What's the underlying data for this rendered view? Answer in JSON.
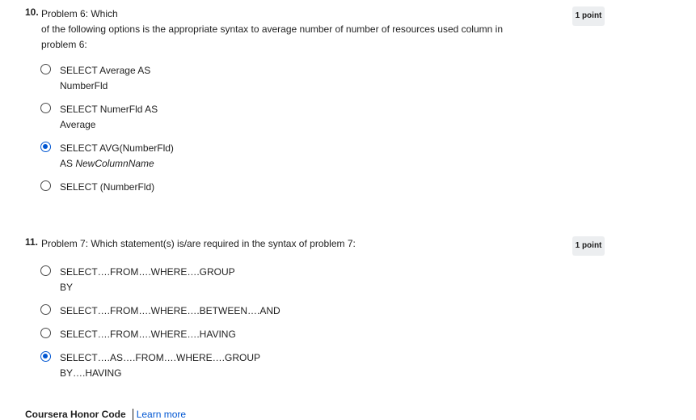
{
  "questions": [
    {
      "number": "10.",
      "text_line1": "Problem 6: Which",
      "text_line2": "of the following options is the appropriate syntax to average number of number of resources used column in",
      "text_line3": "problem 6:",
      "points": "1 point",
      "options": [
        {
          "line1": "SELECT Average AS",
          "line2": "NumberFld",
          "checked": false
        },
        {
          "line1": "SELECT NumerFld AS",
          "line2": "Average",
          "checked": false
        },
        {
          "line1": "SELECT AVG(NumberFld)",
          "line2_prefix": "AS ",
          "line2_italic": "NewColumnName",
          "checked": true
        },
        {
          "line1": "SELECT (NumberFld)",
          "checked": false
        }
      ]
    },
    {
      "number": "11.",
      "text_line1": "Problem 7: Which statement(s) is/are required in the syntax of problem 7:",
      "points": "1 point",
      "options": [
        {
          "line1": "SELECT….FROM….WHERE….GROUP",
          "line2": "BY",
          "checked": false
        },
        {
          "line1": "SELECT….FROM….WHERE….BETWEEN….AND",
          "checked": false
        },
        {
          "line1": "SELECT….FROM….WHERE….HAVING",
          "checked": false
        },
        {
          "line1": "SELECT….AS….FROM….WHERE….GROUP",
          "line2": "BY….HAVING",
          "checked": true
        }
      ]
    }
  ],
  "footer": {
    "honor_code": "Coursera Honor Code",
    "learn_more": "Learn more"
  },
  "colors": {
    "accent": "#0056d2",
    "badge_bg": "#eceef0"
  }
}
